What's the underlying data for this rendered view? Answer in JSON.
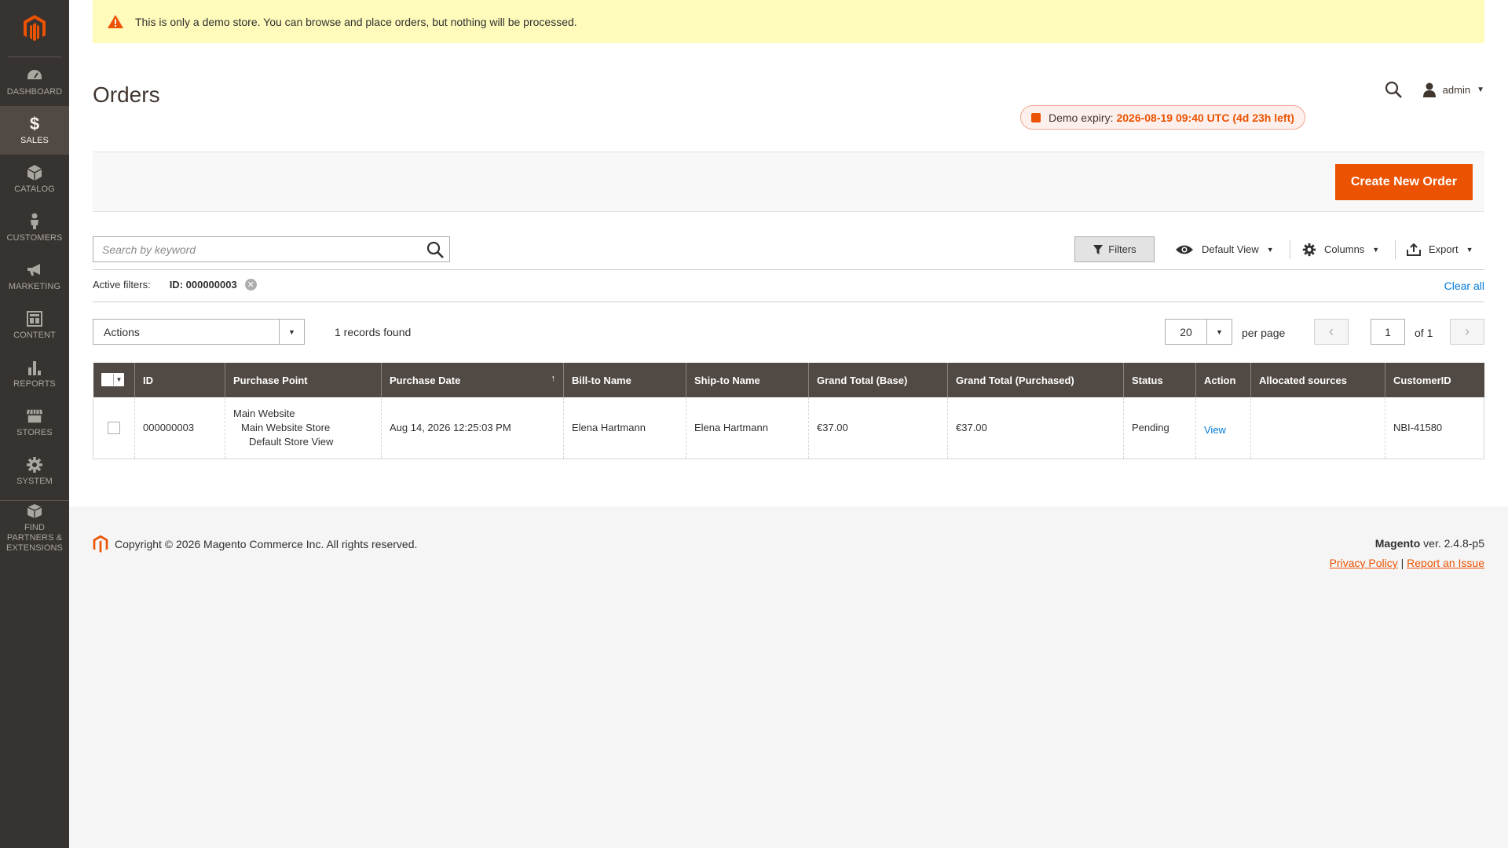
{
  "sidebar": {
    "items": [
      {
        "label": "DASHBOARD",
        "icon": "dashboard-icon"
      },
      {
        "label": "SALES",
        "icon": "dollar-icon"
      },
      {
        "label": "CATALOG",
        "icon": "cube-icon"
      },
      {
        "label": "CUSTOMERS",
        "icon": "person-icon"
      },
      {
        "label": "MARKETING",
        "icon": "megaphone-icon"
      },
      {
        "label": "CONTENT",
        "icon": "layout-icon"
      },
      {
        "label": "REPORTS",
        "icon": "bar-chart-icon"
      },
      {
        "label": "STORES",
        "icon": "store-icon"
      },
      {
        "label": "SYSTEM",
        "icon": "gear-icon"
      }
    ],
    "partners_label": "FIND PARTNERS & EXTENSIONS",
    "active": "SALES"
  },
  "notice": {
    "text": "This is only a demo store. You can browse and place orders, but nothing will be processed."
  },
  "header": {
    "title": "Orders",
    "user": "admin",
    "expiry_label": "Demo expiry:",
    "expiry_value": "2026-08-19 09:40 UTC (4d 23h left)"
  },
  "page_actions": {
    "create_label": "Create New Order"
  },
  "toolbar": {
    "search_placeholder": "Search by keyword",
    "filters_label": "Filters",
    "view_label": "Default View",
    "columns_label": "Columns",
    "export_label": "Export"
  },
  "active_filters": {
    "label": "Active filters:",
    "chip": "ID: 000000003",
    "clear_all": "Clear all"
  },
  "grid_controls": {
    "actions_label": "Actions",
    "records": "1 records found",
    "per_page_value": "20",
    "per_page_label": "per page",
    "page_current": "1",
    "page_of": "of 1"
  },
  "grid": {
    "columns": [
      "ID",
      "Purchase Point",
      "Purchase Date",
      "Bill-to Name",
      "Ship-to Name",
      "Grand Total (Base)",
      "Grand Total (Purchased)",
      "Status",
      "Action",
      "Allocated sources",
      "CustomerID"
    ],
    "sort_indicator": "↑",
    "rows": [
      {
        "id": "000000003",
        "purchase_point": [
          "Main Website",
          "Main Website Store",
          "Default Store View"
        ],
        "purchase_date": "Aug 14, 2026 12:25:03 PM",
        "bill_to": "Elena Hartmann",
        "ship_to": "Elena Hartmann",
        "total_base": "€37.00",
        "total_purchased": "€37.00",
        "status": "Pending",
        "action": "View",
        "allocated": "",
        "customer_id": "NBI-41580"
      }
    ]
  },
  "footer": {
    "copyright": "Copyright © 2026 Magento Commerce Inc. All rights reserved.",
    "brand": "Magento",
    "version": "ver. 2.4.8-p5",
    "privacy": "Privacy Policy",
    "separator": "|",
    "report": "Report an Issue"
  },
  "colors": {
    "accent": "#eb5202",
    "sidebar": "#373330",
    "header_row": "#514943",
    "link": "#007bdb",
    "notice_bg": "#fffbbb"
  }
}
